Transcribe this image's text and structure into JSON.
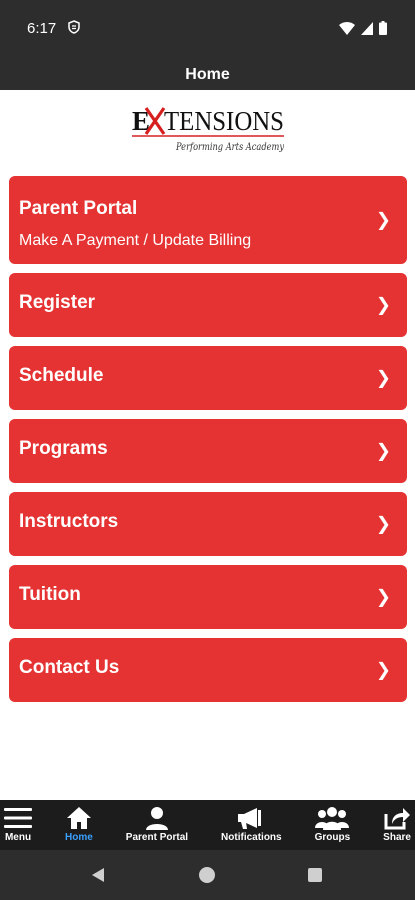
{
  "status_bar": {
    "time": "6:17"
  },
  "header": {
    "title": "Home"
  },
  "logo": {
    "brand": "EXTENSIONS",
    "tagline": "Performing Arts Academy"
  },
  "menu": {
    "items": [
      {
        "label": "Parent Portal",
        "sub": "Make A Payment / Update Billing",
        "chevron": "❯"
      },
      {
        "label": "Register",
        "chevron": "❯"
      },
      {
        "label": "Schedule",
        "chevron": "❯"
      },
      {
        "label": "Programs",
        "chevron": "❯"
      },
      {
        "label": "Instructors",
        "chevron": "❯"
      },
      {
        "label": "Tuition",
        "chevron": "❯"
      },
      {
        "label": "Contact Us",
        "chevron": "❯"
      }
    ]
  },
  "tabs": [
    {
      "label": "Menu",
      "icon": "hamburger-icon"
    },
    {
      "label": "Home",
      "icon": "home-icon",
      "active": true
    },
    {
      "label": "Parent Portal",
      "icon": "person-icon"
    },
    {
      "label": "Notifications",
      "icon": "megaphone-icon"
    },
    {
      "label": "Groups",
      "icon": "group-icon"
    },
    {
      "label": "Share",
      "icon": "share-icon"
    }
  ],
  "colors": {
    "accent": "#e53232",
    "bar": "#2d2d2d",
    "active_tab": "#3aa0ff"
  }
}
